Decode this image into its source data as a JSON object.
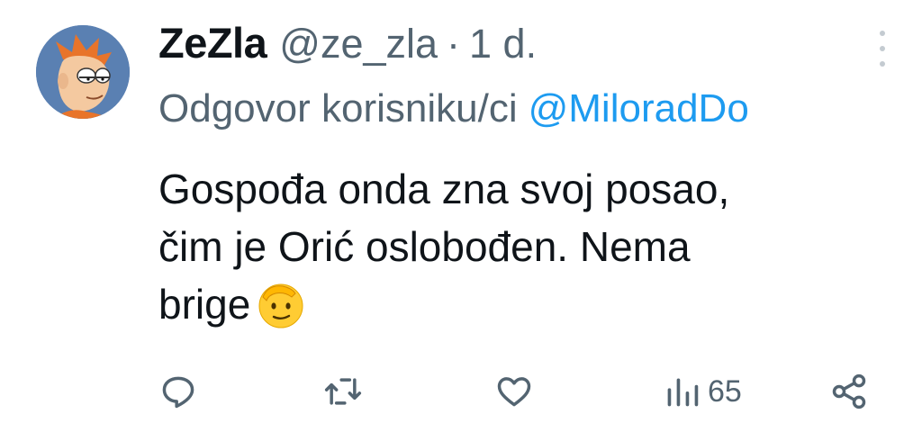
{
  "tweet": {
    "display_name": "ZeZla",
    "handle": "@ze_zla",
    "separator": "·",
    "time": "1 d.",
    "reply_label": "Odgovor korisniku/ci",
    "reply_mention": "@MiloradDo",
    "text_lines": [
      "Gospođa onda zna svoj posao,",
      "čim je Orić oslobođen. Nema",
      "brige"
    ],
    "emoji": "saluting-face",
    "views": "65"
  },
  "colors": {
    "primary_text": "#0f1419",
    "secondary_text": "#536471",
    "link": "#1d9bf0"
  },
  "icons": {
    "reply": "reply-icon",
    "retweet": "retweet-icon",
    "like": "heart-icon",
    "views": "views-icon",
    "share": "share-icon",
    "more": "more-options-icon"
  }
}
